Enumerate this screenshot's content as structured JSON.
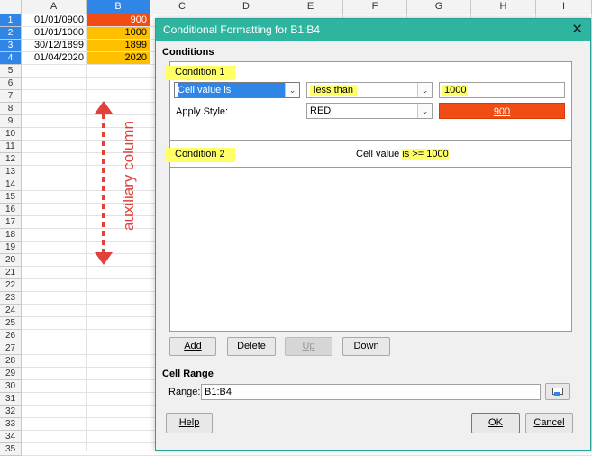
{
  "sheet": {
    "columns": [
      "A",
      "B",
      "C",
      "D",
      "E",
      "F",
      "G",
      "H",
      "I"
    ],
    "rows": [
      "1",
      "2",
      "3",
      "4",
      "5",
      "6",
      "7",
      "8",
      "9",
      "10",
      "11",
      "12",
      "13",
      "14",
      "15",
      "16",
      "17",
      "18",
      "19",
      "20",
      "21",
      "22",
      "23",
      "24",
      "25",
      "26",
      "27",
      "28",
      "29",
      "30",
      "31",
      "32",
      "33",
      "34",
      "35"
    ],
    "colA": [
      "01/01/0900",
      "01/01/1000",
      "30/12/1899",
      "01/04/2020"
    ],
    "colB": [
      "900",
      "1000",
      "1899",
      "2020"
    ],
    "colB_colors": [
      "#f04c14",
      "#ffc000",
      "#ffc000",
      "#ffc000"
    ],
    "annotation": "auxiliary column",
    "annotation_color": "#e0413a"
  },
  "dialog": {
    "title": "Conditional Formatting for B1:B4",
    "close_glyph": "✕",
    "conditions_label": "Conditions",
    "condition1": {
      "label": "Condition 1",
      "type_value": "Cell value is",
      "operator": "less than",
      "value": "1000",
      "apply_style_label": "Apply Style:",
      "style_value": "RED",
      "preview_text": "900"
    },
    "condition2": {
      "label": "Condition 2",
      "summary_prefix": "Cell value ",
      "summary_rule": "is >= 1000"
    },
    "buttons": {
      "add": "Add",
      "delete": "Delete",
      "up": "Up",
      "down": "Down"
    },
    "cell_range_label": "Cell Range",
    "range_label": "Range:",
    "range_value": "B1:B4",
    "footer": {
      "help": "Help",
      "ok": "OK",
      "cancel": "Cancel"
    }
  }
}
